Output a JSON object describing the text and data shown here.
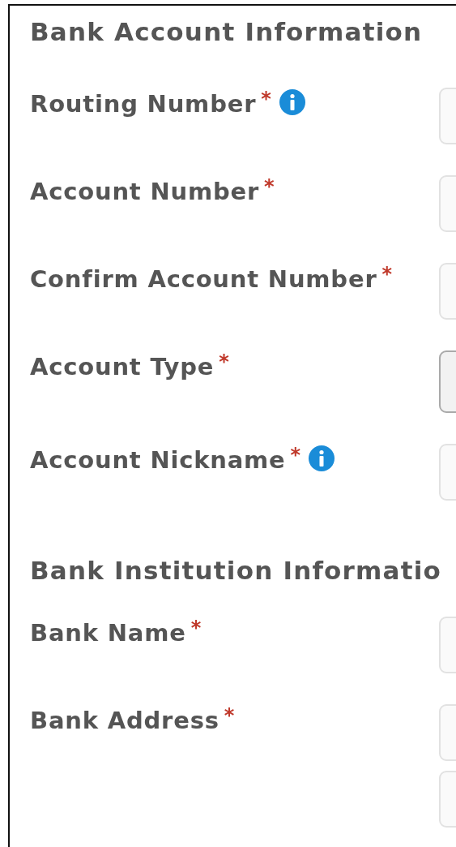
{
  "sections": [
    {
      "title": "Bank Account Information",
      "fields": [
        {
          "label": "Routing Number",
          "required_mark": "*",
          "info": true,
          "inputs": [
            {
              "kind": "text"
            }
          ]
        },
        {
          "label": "Account Number",
          "required_mark": "*",
          "inputs": [
            {
              "kind": "text"
            }
          ]
        },
        {
          "label": "Confirm Account Number",
          "required_mark": "*",
          "inputs": [
            {
              "kind": "text"
            }
          ]
        },
        {
          "label": "Account Type",
          "required_mark": "*",
          "inputs": [
            {
              "kind": "select"
            }
          ]
        },
        {
          "label": "Account Nickname",
          "required_mark": "*",
          "info": true,
          "inputs": [
            {
              "kind": "text"
            }
          ]
        }
      ]
    },
    {
      "title": "Bank Institution Informatio",
      "fields": [
        {
          "label": "Bank Name",
          "required_mark": "*",
          "inputs": [
            {
              "kind": "text"
            }
          ]
        },
        {
          "label": "Bank Address",
          "required_mark": "*",
          "inputs": [
            {
              "kind": "text"
            },
            {
              "kind": "text"
            }
          ]
        }
      ]
    }
  ]
}
